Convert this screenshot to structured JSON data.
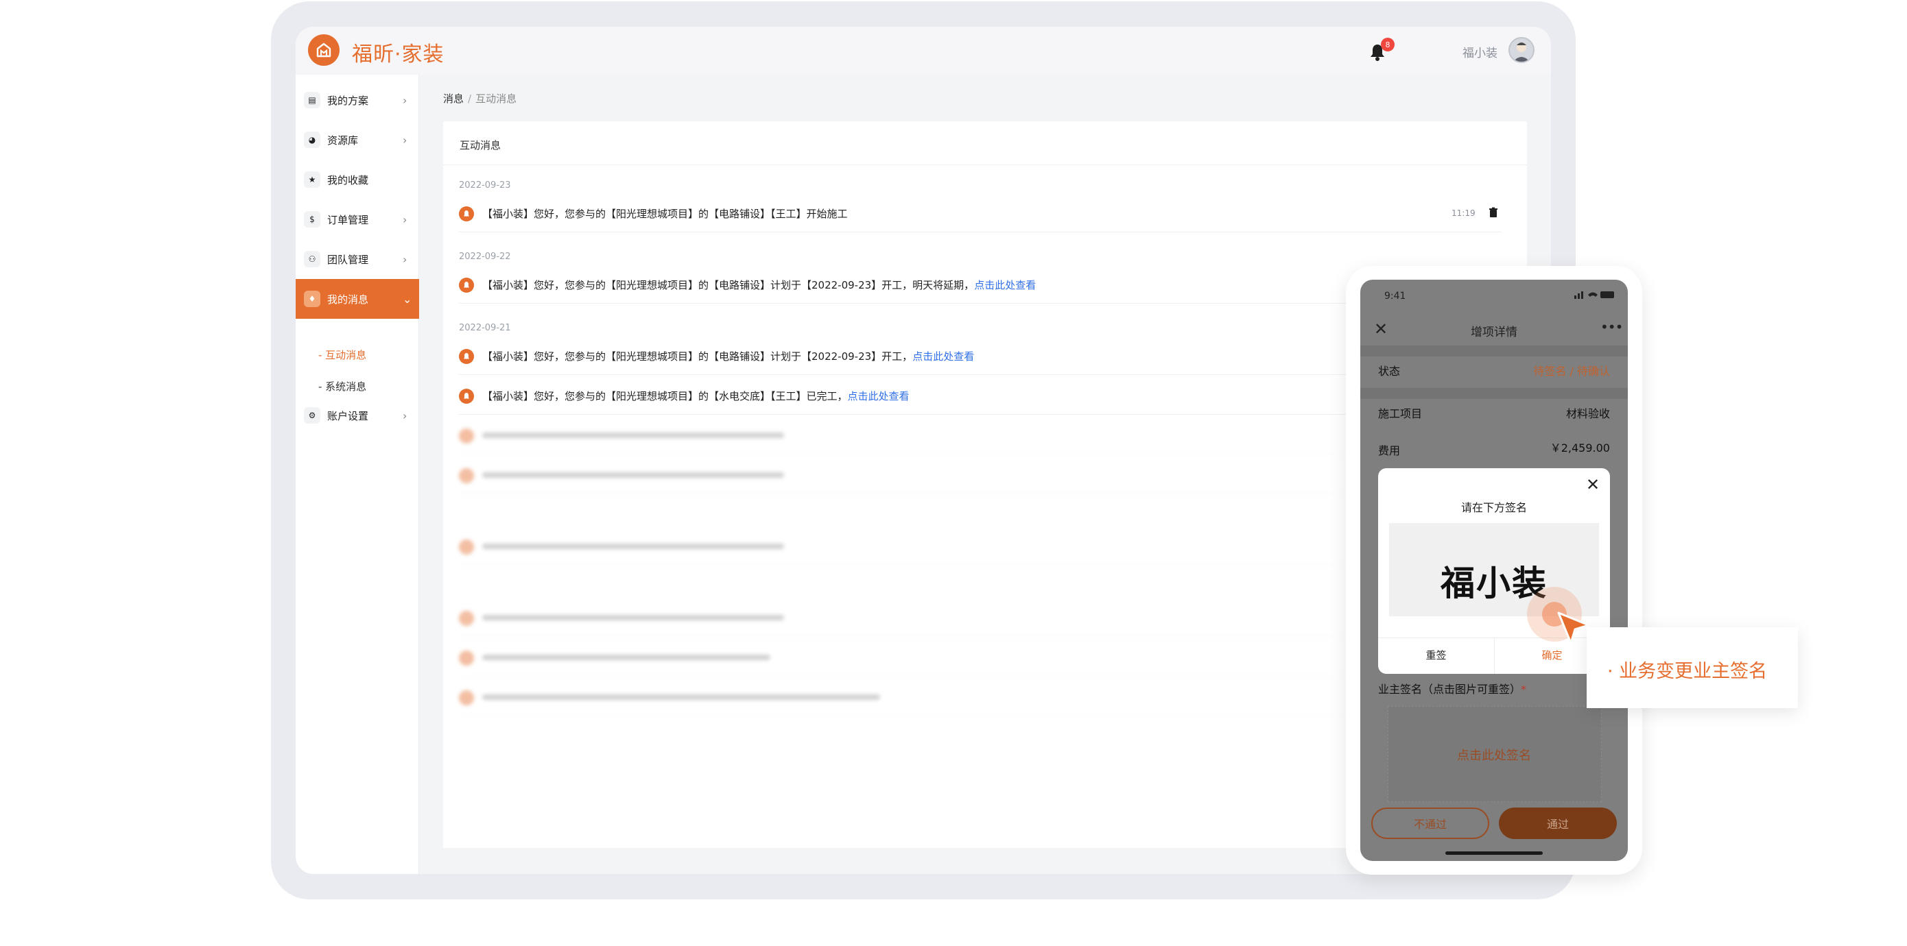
{
  "app": {
    "logo_text": "福昕·家装",
    "notification_count": "8",
    "user_name": "福小装"
  },
  "sidebar": {
    "items": [
      {
        "label": "我的方案",
        "icon": "document-icon"
      },
      {
        "label": "资源库",
        "icon": "palette-icon"
      },
      {
        "label": "我的收藏",
        "icon": "star-icon"
      },
      {
        "label": "订单管理",
        "icon": "dollar-icon"
      },
      {
        "label": "团队管理",
        "icon": "team-icon"
      },
      {
        "label": "我的消息",
        "icon": "bell-icon"
      },
      {
        "label": "账户设置",
        "icon": "gear-icon"
      }
    ],
    "sub_items": [
      {
        "label": "- 互动消息"
      },
      {
        "label": "- 系统消息"
      }
    ]
  },
  "breadcrumb": {
    "root": "消息",
    "separator": "/",
    "current": "互动消息"
  },
  "panel": {
    "title": "互动消息",
    "groups": [
      {
        "date": "2022-09-23"
      },
      {
        "date": "2022-09-22"
      },
      {
        "date": "2022-09-21"
      }
    ],
    "messages": [
      {
        "text": "【福小装】您好，您参与的【阳光理想城项目】的【电路铺设】【王工】开始施工",
        "link": "",
        "time": "11:19"
      },
      {
        "text": "【福小装】您好，您参与的【阳光理想城项目】的【电路铺设】计划于【2022-09-23】开工，明天将延期，",
        "link": "点击此处查看",
        "time": ""
      },
      {
        "text": "【福小装】您好，您参与的【阳光理想城项目】的【电路铺设】计划于【2022-09-23】开工，",
        "link": "点击此处查看",
        "time": ""
      },
      {
        "text": "【福小装】您好，您参与的【阳光理想城项目】的【水电交底】【王工】已完工，",
        "link": "点击此处查看",
        "time": ""
      }
    ]
  },
  "phone": {
    "status_time": "9:41",
    "title": "增项详情",
    "rows": [
      {
        "label": "状态",
        "value": "待签名 / 待确认"
      },
      {
        "label": "施工项目",
        "value": "材料验收"
      },
      {
        "label": "费用",
        "value": "￥2,459.00"
      }
    ],
    "sign_label": "业主签名（点击图片可重签）",
    "sign_required": "*",
    "sign_hint": "点击此处签名",
    "reject_label": "不通过",
    "pass_label": "通过",
    "modal": {
      "title": "请在下方签名",
      "signature": "福小装",
      "reset_label": "重签",
      "confirm_label": "确定"
    }
  },
  "callout": {
    "text": "· 业务变更业主签名"
  },
  "colors": {
    "accent": "#e56e2f",
    "link": "#2f6fe8",
    "badge": "#f0473f"
  }
}
